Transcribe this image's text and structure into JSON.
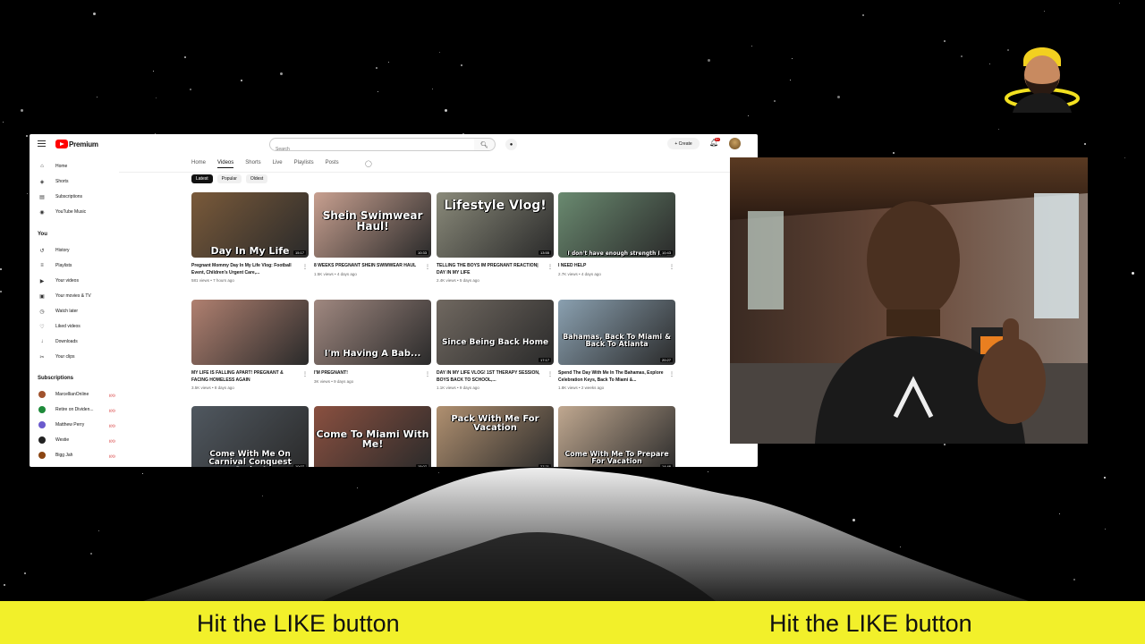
{
  "youtube": {
    "logo_text": "Premium",
    "search_placeholder": "Search",
    "create_label": "Create",
    "notif_count": "9+",
    "sidebar": {
      "main": [
        {
          "label": "Home",
          "icon": "home-icon"
        },
        {
          "label": "Shorts",
          "icon": "shorts-icon"
        },
        {
          "label": "Subscriptions",
          "icon": "subscriptions-icon"
        },
        {
          "label": "YouTube Music",
          "icon": "music-icon"
        }
      ],
      "you_label": "You",
      "you_items": [
        {
          "label": "History",
          "icon": "history-icon"
        },
        {
          "label": "Playlists",
          "icon": "playlists-icon"
        },
        {
          "label": "Your videos",
          "icon": "your-videos-icon"
        },
        {
          "label": "Your movies & TV",
          "icon": "movies-icon"
        },
        {
          "label": "Watch later",
          "icon": "watch-later-icon"
        },
        {
          "label": "Liked videos",
          "icon": "liked-icon"
        },
        {
          "label": "Downloads",
          "icon": "downloads-icon"
        },
        {
          "label": "Your clips",
          "icon": "clips-icon"
        }
      ],
      "subscriptions_label": "Subscriptions",
      "subscriptions": [
        {
          "label": "MarcellianOnline",
          "color": "#a0522d"
        },
        {
          "label": "Retire on Dividen...",
          "color": "#1e8a3a"
        },
        {
          "label": "Matthew Perry",
          "color": "#6a5acd"
        },
        {
          "label": "Westie",
          "color": "#222222"
        },
        {
          "label": "Bigg Jah",
          "color": "#8b4513"
        }
      ]
    },
    "channel_tabs": [
      "Home",
      "Videos",
      "Shorts",
      "Live",
      "Playlists",
      "Posts"
    ],
    "active_tab": "Videos",
    "chips": [
      "Latest",
      "Popular",
      "Oldest"
    ],
    "videos": [
      {
        "title": "Pregnant Mommy Day In My Life Vlog: Football Event, Children's Urgent Care,...",
        "meta": "581 views • 7 hours ago",
        "duration": "15:17",
        "thumb_text": "Day In My Life",
        "bg": "#7a5a3a"
      },
      {
        "title": "8 WEEKS PREGNANT SHEIN SWIMWEAR HAUL",
        "meta": "1.5K views • 4 days ago",
        "duration": "10:33",
        "thumb_text": "Shein Swimwear Haul!",
        "bg": "#c8a090"
      },
      {
        "title": "TELLING THE BOYS IM PREGNANT REACTION| DAY IN MY LIFE",
        "meta": "2.4K views • 5 days ago",
        "duration": "13:55",
        "thumb_text": "Lifestyle Vlog!",
        "bg": "#8a8a7a"
      },
      {
        "title": "I NEED HELP",
        "meta": "2.7K views • 4 days ago",
        "duration": "10:43",
        "thumb_text": "I don't have enough strength I...",
        "bg": "#6a8a70"
      },
      {
        "title": "MY LIFE IS FALLING APART! PREGNANT & FACING HOMELESS AGAIN",
        "meta": "3.5K views • 8 days ago",
        "duration": "",
        "thumb_text": "",
        "bg": "#b08070"
      },
      {
        "title": "I'M PREGNANT!",
        "meta": "3K views • 9 days ago",
        "duration": "",
        "thumb_text": "I'm Having A Bab...",
        "bg": "#a08880"
      },
      {
        "title": "DAY IN MY LIFE VLOG! 1ST THERAPY SESSION, BOYS BACK TO SCHOOL,...",
        "meta": "1.1K views • 9 days ago",
        "duration": "17:17",
        "thumb_text": "Since Being Back Home",
        "bg": "#706860"
      },
      {
        "title": "Spend The Day With Me In The Bahamas, Explore Celebration Keys, Back To Miami &...",
        "meta": "1.8K views • 2 weeks ago",
        "duration": "20:27",
        "thumb_text": "Bahamas, Back To Miami & Back To Atlanta",
        "bg": "#8aa0b0"
      },
      {
        "title": "",
        "meta": "",
        "duration": "10:07",
        "thumb_text": "Come With Me On Carnival Conquest Cruise!",
        "bg": "#505860"
      },
      {
        "title": "",
        "meta": "",
        "duration": "15:07",
        "thumb_text": "Come To Miami With Me!",
        "bg": "#8a5040"
      },
      {
        "title": "",
        "meta": "",
        "duration": "27:21",
        "thumb_text": "Pack With Me For Vacation",
        "bg": "#b09070"
      },
      {
        "title": "",
        "meta": "",
        "duration": "14:46",
        "thumb_text": "Come With Me To Prepare For Vacation",
        "bg": "#c0a890"
      }
    ]
  },
  "banner": {
    "left_text": "Hit the LIKE button",
    "right_text": "Hit the LIKE button",
    "color": "#f2f02a"
  }
}
